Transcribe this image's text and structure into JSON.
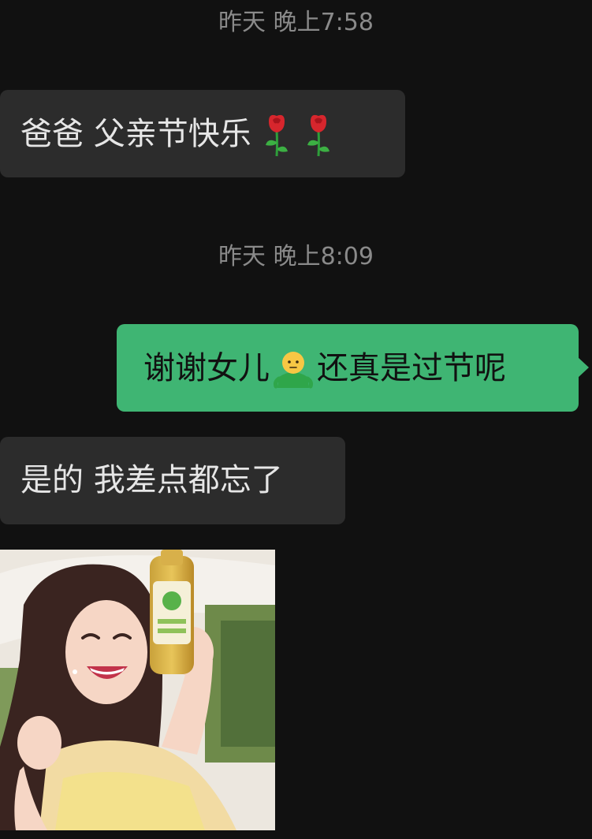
{
  "chat": {
    "timestamps": [
      "昨天 晚上7:58",
      "昨天 晚上8:09"
    ],
    "messages": [
      {
        "direction": "incoming",
        "text_before": "爸爸 父亲节快乐",
        "emojis": [
          "rose-emoji",
          "rose-emoji"
        ]
      },
      {
        "direction": "outgoing",
        "text_before": "谢谢女儿",
        "emoji": "standing-person-emoji",
        "text_after": "还真是过节呢"
      },
      {
        "direction": "incoming",
        "text": "是的 我差点都忘了"
      },
      {
        "direction": "incoming",
        "type": "image",
        "image": "woman-smiling-holding-bottle-photo"
      }
    ]
  },
  "colors": {
    "background": "#111111",
    "incoming_bubble": "#2c2c2c",
    "outgoing_bubble": "#3fb573",
    "timestamp_text": "#8a8a8a"
  }
}
